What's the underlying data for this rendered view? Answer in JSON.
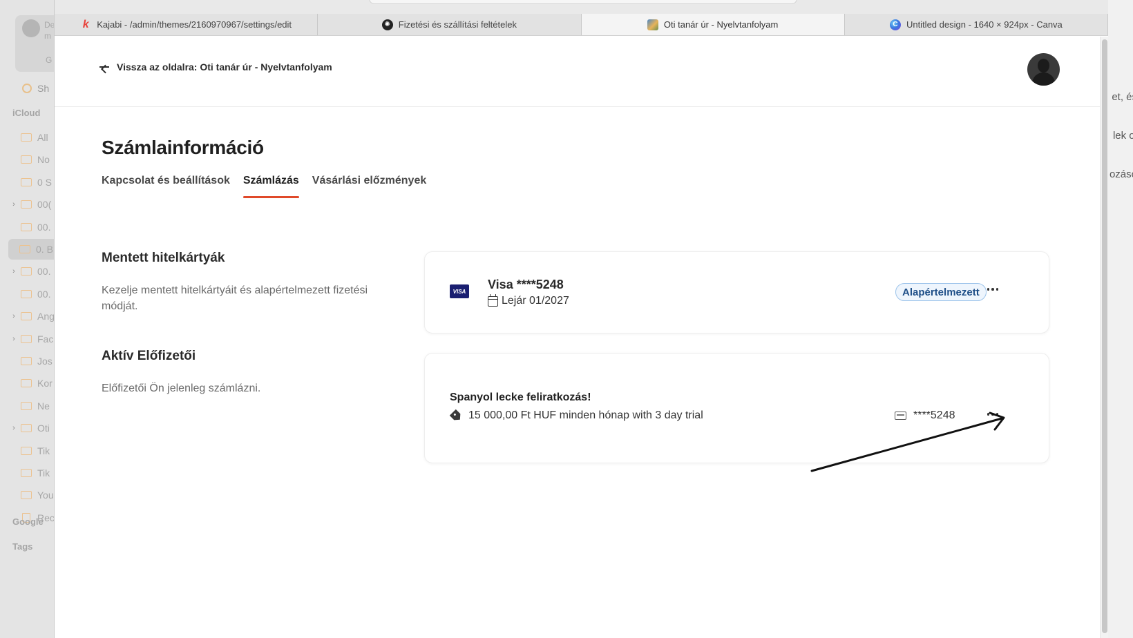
{
  "finder": {
    "account_lines": [
      "De",
      "m"
    ],
    "account_sub": "G",
    "shared_label": "Sh",
    "icloud_label": "iCloud",
    "items": [
      {
        "label": "All",
        "chevron": false
      },
      {
        "label": "No",
        "chevron": false
      },
      {
        "label": "0 S",
        "chevron": false
      },
      {
        "label": "00(",
        "chevron": true
      },
      {
        "label": "00.",
        "chevron": false
      },
      {
        "label": "0. B",
        "chevron": false,
        "selected": true
      },
      {
        "label": "00.",
        "chevron": true
      },
      {
        "label": "00.",
        "chevron": false
      },
      {
        "label": "Ang",
        "chevron": true
      },
      {
        "label": "Fac",
        "chevron": true
      },
      {
        "label": "Jos",
        "chevron": false
      },
      {
        "label": "Kor",
        "chevron": false
      },
      {
        "label": "Ne",
        "chevron": false
      },
      {
        "label": "Oti",
        "chevron": true
      },
      {
        "label": "Tik",
        "chevron": false
      },
      {
        "label": "Tik",
        "chevron": false
      },
      {
        "label": "You",
        "chevron": false
      },
      {
        "label": "Rec",
        "chevron": false,
        "trash": true
      }
    ],
    "google_label": "Google",
    "tags_label": "Tags"
  },
  "right_bg": [
    "et, és",
    "lek ol",
    "ozáso"
  ],
  "browser": {
    "tabs": [
      {
        "label": "Kajabi - /admin/themes/2160970967/settings/edit",
        "icon": "kajabi-icon",
        "icon_glyph": "k",
        "active": false
      },
      {
        "label": "Fizetési és szállítási feltételek",
        "icon": "openai-icon",
        "icon_glyph": "✺",
        "active": false
      },
      {
        "label": "Oti tanár úr - Nyelvtanfolyam",
        "icon": "site-thumbnail-icon",
        "icon_glyph": "",
        "active": true
      },
      {
        "label": "Untitled design - 1640 × 924px - Canva",
        "icon": "canva-icon",
        "icon_glyph": "C",
        "active": false
      }
    ]
  },
  "header": {
    "back_link": "Vissza az oldalra: Oti tanár úr - Nyelvtanfolyam"
  },
  "page": {
    "title": "Számlainformáció",
    "tabs": [
      {
        "label": "Kapcsolat és beállítások",
        "active": false
      },
      {
        "label": "Számlázás",
        "active": true
      },
      {
        "label": "Vásárlási előzmények",
        "active": false
      }
    ],
    "cards_section": {
      "title": "Mentett hitelkártyák",
      "description": "Kezelje mentett hitelkártyáit és alapértelmezett fizetési módját."
    },
    "subs_section": {
      "title": "Aktív Előfizetői",
      "description": "Előfizetői Ön jelenleg számlázni."
    },
    "saved_card": {
      "brand_logo": "VISA",
      "name": "Visa ****5248",
      "expiry": "Lejár 01/2027",
      "badge": "Alapértelmezett"
    },
    "subscription": {
      "name": "Spanyol lecke feliratkozás!",
      "price": "15 000,00 Ft HUF minden hónap with 3 day trial",
      "card": "****5248"
    }
  },
  "colors": {
    "accent_underline": "#e0492a",
    "badge_border": "#9cc3ea",
    "badge_text": "#1f4f88",
    "visa_blue": "#1a1f71"
  }
}
